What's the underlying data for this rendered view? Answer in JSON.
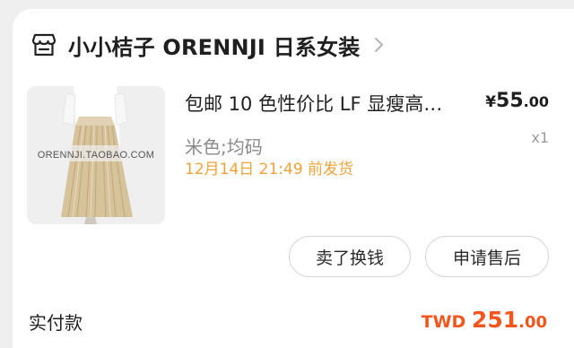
{
  "shop": {
    "icon": "storefront-icon",
    "name": "小小桔子 ORENNJI 日系女装",
    "chevron_icon": "chevron-right-icon"
  },
  "item": {
    "thumbnail_text": "ORENNJI.TAOBAO.COM",
    "title": "包邮 10 色性价比 LF 显瘦高…",
    "price": {
      "currency": "¥",
      "integer": "55",
      "decimal": ".00"
    },
    "variant": "米色;均码",
    "quantity": "x1",
    "shipping": "12月14日 21:49 前发货"
  },
  "actions": {
    "sell_label": "卖了换钱",
    "after_sale_label": "申请售后"
  },
  "summary": {
    "paid_label": "实付款",
    "total": {
      "currency": "TWD ",
      "integer": "251",
      "decimal": ".00"
    }
  },
  "colors": {
    "shipping": "#f2a23a",
    "total": "#f0561d"
  }
}
